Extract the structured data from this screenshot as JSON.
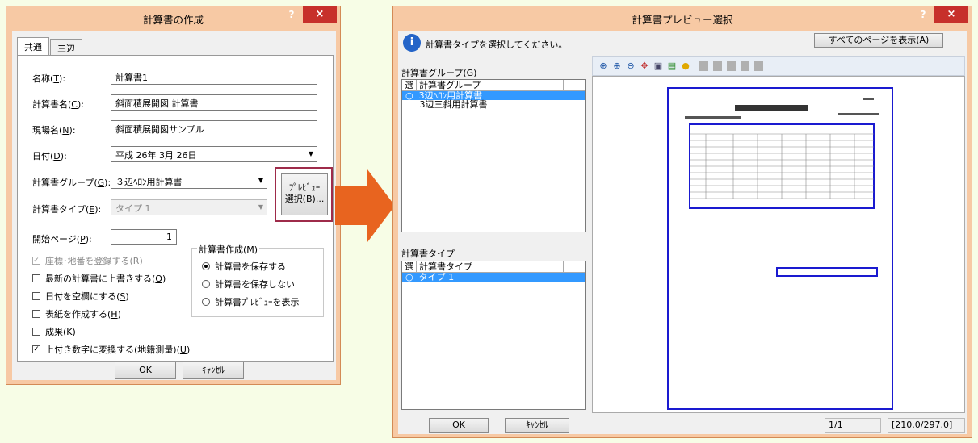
{
  "left_dialog": {
    "title": "計算書の作成",
    "help": "?",
    "close": "×",
    "tabs": [
      "共通",
      "三辺"
    ],
    "fields": {
      "name_label": "名称(",
      "name_key": "T",
      "name_value": "計算書1",
      "docname_label": "計算書名(",
      "docname_key": "C",
      "docname_value": "斜面積展開図 計算書",
      "site_label": "現場名(",
      "site_key": "N",
      "site_value": "斜面積展開図サンプル",
      "date_label": "日付(",
      "date_key": "D",
      "date_value": "平成 26年  3月 26日",
      "group_label": "計算書グループ(",
      "group_key": "G",
      "group_value": "３辺ﾍﾛﾝ用計算書",
      "type_label": "計算書タイプ(",
      "type_key": "E",
      "type_value": "タイプ 1",
      "start_label": "開始ページ(",
      "start_key": "P",
      "start_value": "1",
      "close_paren": "):"
    },
    "preview_button": {
      "line1": "ﾌﾟﾚﾋﾞｭｰ",
      "line2": "選択(",
      "key": "B",
      "suffix": ")..."
    },
    "checks": [
      {
        "label": "座標･地番を登録する(",
        "key": "R",
        "checked": true,
        "disabled": true
      },
      {
        "label": "最新の計算書に上書きする(",
        "key": "O",
        "checked": false,
        "disabled": false
      },
      {
        "label": "日付を空欄にする(",
        "key": "S",
        "checked": false,
        "disabled": false
      },
      {
        "label": "表紙を作成する(",
        "key": "H",
        "checked": false,
        "disabled": false
      },
      {
        "label": "成果(",
        "key": "K",
        "checked": false,
        "disabled": false
      },
      {
        "label": "上付き数字に変換する(地籍測量)(",
        "key": "U",
        "checked": true,
        "disabled": false
      }
    ],
    "create_group": {
      "title": "計算書作成(M)",
      "options": [
        "計算書を保存する",
        "計算書を保存しない",
        "計算書ﾌﾟﾚﾋﾞｭｰを表示"
      ],
      "selected": 0
    },
    "ok": "OK",
    "cancel": "ｷｬﾝｾﾙ"
  },
  "right_dialog": {
    "title": "計算書プレビュー選択",
    "help": "?",
    "close": "×",
    "info_text": "計算書タイプを選択してください。",
    "show_all_button": "すべてのページを表示(",
    "show_all_key": "A",
    "group_label": "計算書グループ(",
    "group_key": "G",
    "group_list": {
      "headers": [
        "選",
        "計算書グループ"
      ],
      "items": [
        {
          "mark": "○",
          "name": "3辺ﾍﾛﾝ用計算書",
          "selected": true
        },
        {
          "mark": "",
          "name": "3辺三斜用計算書",
          "selected": false
        }
      ]
    },
    "type_label": "計算書タイプ",
    "type_list": {
      "headers": [
        "選",
        "計算書タイプ"
      ],
      "items": [
        {
          "mark": "○",
          "name": "タイプ 1",
          "selected": true
        }
      ]
    },
    "ok": "OK",
    "cancel": "ｷｬﾝｾﾙ",
    "page_counter": "1/1",
    "paper_size": "[210.0/297.0]",
    "toolbar_icons": [
      "zoom-in-icon",
      "zoom-fit-icon",
      "zoom-out-icon",
      "pan-icon",
      "fit-page-icon",
      "export-icon",
      "bulb-icon"
    ]
  },
  "colors": {
    "accent_frame": "#f7c9a4",
    "selection": "#3399ff",
    "paper_border": "#1a1ad0",
    "arrow": "#e8641f",
    "highlight": "#9e2b4a"
  }
}
